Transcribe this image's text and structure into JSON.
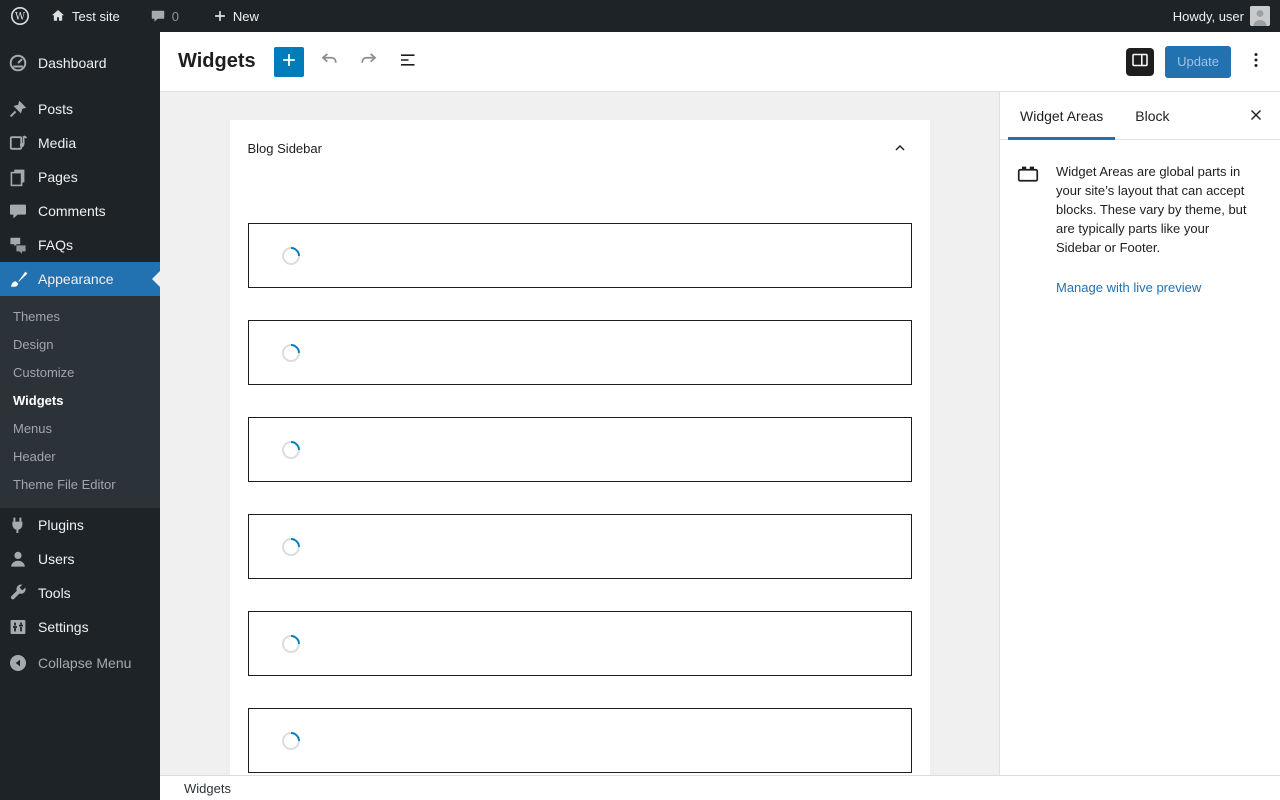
{
  "admin_bar": {
    "site_name": "Test site",
    "comment_count": "0",
    "new_label": "New",
    "howdy": "Howdy, user"
  },
  "sidebar": {
    "items": [
      {
        "label": "Dashboard",
        "icon": "dashboard-icon"
      },
      {
        "label": "Posts",
        "icon": "pushpin-icon",
        "gap": true
      },
      {
        "label": "Media",
        "icon": "media-icon"
      },
      {
        "label": "Pages",
        "icon": "pages-icon"
      },
      {
        "label": "Comments",
        "icon": "comment-icon"
      },
      {
        "label": "FAQs",
        "icon": "chat-bubbles-icon"
      },
      {
        "label": "Appearance",
        "icon": "paintbrush-icon",
        "active": true,
        "submenu": [
          "Themes",
          "Design",
          "Customize",
          "Widgets",
          "Menus",
          "Header",
          "Theme File Editor"
        ],
        "current_submenu": "Widgets"
      },
      {
        "label": "Plugins",
        "icon": "plug-icon"
      },
      {
        "label": "Users",
        "icon": "user-icon"
      },
      {
        "label": "Tools",
        "icon": "wrench-icon"
      },
      {
        "label": "Settings",
        "icon": "sliders-icon"
      },
      {
        "label": "Collapse Menu",
        "icon": "collapse-arrow-icon",
        "muted": true,
        "gap_sm": true
      }
    ]
  },
  "editor_header": {
    "title": "Widgets",
    "update_label": "Update",
    "icons": [
      "plus-icon",
      "undo-icon",
      "redo-icon",
      "document-overview-icon",
      "sidebar-toggle-icon",
      "kebab-menu-icon"
    ]
  },
  "canvas": {
    "widget_area_title": "Blog Sidebar",
    "loading_block_count": 6
  },
  "settings_panel": {
    "tabs": [
      {
        "label": "Widget Areas",
        "active": true
      },
      {
        "label": "Block",
        "active": false
      }
    ],
    "description": "Widget Areas are global parts in your site’s layout that can accept blocks. These vary by theme, but are typically parts like your Sidebar or Footer.",
    "link_label": "Manage with live preview"
  },
  "footer": {
    "breadcrumb": "Widgets"
  },
  "colors": {
    "accent": "#2271b1",
    "inserter_blue": "#007cba",
    "admin_bar_bg": "#1d2327",
    "menu_bg": "#1d2327",
    "submenu_bg": "#2c3338",
    "canvas_bg": "#f0f0f0",
    "block_border": "#1e1e1e",
    "spinner_blue": "#007cba",
    "link_blue": "#2271b1"
  }
}
